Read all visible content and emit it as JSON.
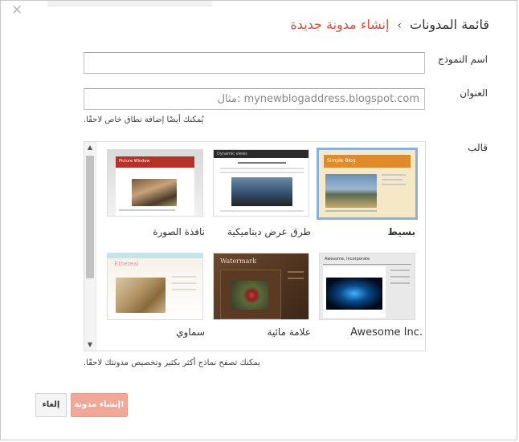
{
  "header": {
    "breadcrumb_parent": "قائمة المدونات",
    "separator": "›",
    "breadcrumb_current": "إنشاء مدونة جديدة"
  },
  "form": {
    "title_label": "اسم النموذج",
    "title_value": "",
    "address_label": "العنوان",
    "address_placeholder": "مثال: mynewblogaddress.blogspot.com",
    "address_hint": "يُمكنك أيضًا إضافة نطاق خاص لاحقًا.",
    "template_label": "قالب",
    "template_hint": "يمكنك تصفح نماذج أكثر بكثير وتخصيص مدونتك لاحقًا."
  },
  "templates": [
    {
      "name": "بسيط",
      "selected": true,
      "preview_header": "Simple Blog",
      "accent": "#e08a2c"
    },
    {
      "name": "طرق عرض ديناميكية",
      "selected": false,
      "preview_header": "Dynamic views",
      "accent": "#2b2b2b"
    },
    {
      "name": "نافذة الصورة",
      "selected": false,
      "preview_header": "Picture Window",
      "accent": "#b4322a"
    },
    {
      "name": "Awesome Inc.",
      "selected": false,
      "preview_header": "Awesome, Incorporate",
      "accent": "#111111"
    },
    {
      "name": "علامة مائية",
      "selected": false,
      "preview_header": "Watermark",
      "accent": "#5a3a22"
    },
    {
      "name": "سماوي",
      "selected": false,
      "preview_header": "Ethereal",
      "accent": "#e88fa0"
    }
  ],
  "buttons": {
    "cancel": "إلغاء",
    "create": "إنشاء مدونة!"
  },
  "icons": {
    "close": "close-icon",
    "scroll_up": "scroll-up-icon",
    "scroll_down": "scroll-down-icon"
  }
}
